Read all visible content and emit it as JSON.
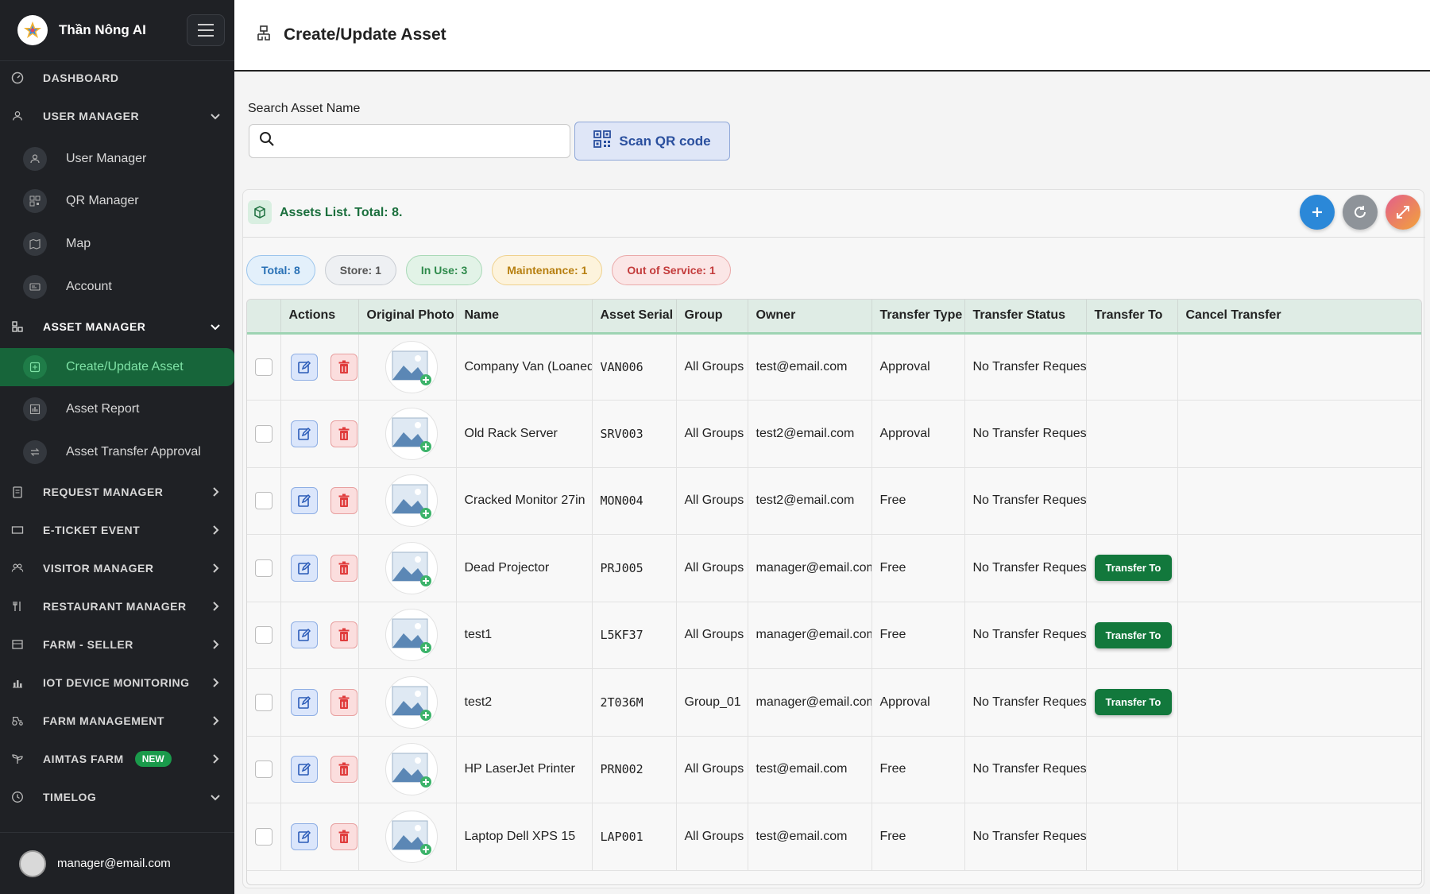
{
  "app": {
    "title": "Thần Nông AI"
  },
  "header": {
    "title": "Create/Update Asset"
  },
  "sidebar": {
    "top_items": [
      {
        "label": "DASHBOARD",
        "icon": "dashboard-icon"
      },
      {
        "label": "USER MANAGER",
        "icon": "users-icon",
        "expanded": true
      },
      {
        "label": "ASSET MANAGER",
        "icon": "asset-manager-icon",
        "expanded": true
      },
      {
        "label": "REQUEST MANAGER",
        "icon": "clipboard-icon"
      },
      {
        "label": "E-TICKET EVENT",
        "icon": "ticket-icon"
      },
      {
        "label": "VISITOR MANAGER",
        "icon": "visitors-icon"
      },
      {
        "label": "RESTAURANT MANAGER",
        "icon": "restaurant-icon"
      },
      {
        "label": "FARM - SELLER",
        "icon": "store-icon"
      },
      {
        "label": "IOT DEVICE MONITORING",
        "icon": "chart-icon"
      },
      {
        "label": "FARM MANAGEMENT",
        "icon": "tractor-icon"
      },
      {
        "label": "AIMTAS FARM",
        "icon": "plant-icon",
        "badge": "NEW"
      },
      {
        "label": "TIMELOG",
        "icon": "clock-icon",
        "expanded": true
      }
    ],
    "user_items": [
      {
        "label": "User Manager"
      },
      {
        "label": "QR Manager"
      },
      {
        "label": "Map"
      },
      {
        "label": "Account"
      }
    ],
    "asset_items": [
      {
        "label": "Create/Update Asset",
        "active": true
      },
      {
        "label": "Asset Report"
      },
      {
        "label": "Asset Transfer Approval"
      }
    ],
    "footer_email": "manager@email.com"
  },
  "search": {
    "label": "Search Asset Name",
    "placeholder": "",
    "value": ""
  },
  "scan_button": {
    "label": "Scan QR code"
  },
  "list": {
    "title": "Assets List. Total: 8.",
    "filters": [
      {
        "label": "Total: 8",
        "color": "#2770b5"
      },
      {
        "label": "Store: 1",
        "color": "#555555"
      },
      {
        "label": "In Use: 3",
        "color": "#2e8a4b"
      },
      {
        "label": "Maintenance: 1",
        "color": "#b77f10"
      },
      {
        "label": "Out of Service: 1",
        "color": "#c33b3b"
      }
    ],
    "columns": [
      "Actions",
      "Original Photo",
      "Name",
      "Asset Serial",
      "Group",
      "Owner",
      "Transfer Type",
      "Transfer Status",
      "Transfer To",
      "Cancel Transfer"
    ],
    "transfer_label": "Transfer To",
    "rows": [
      {
        "name": "Company Van (Loaned)",
        "serial": "VAN006",
        "group": "All Groups",
        "owner": "test@email.com",
        "transfer_type": "Approval",
        "transfer_status": "No Transfer Request",
        "transfer_to": false
      },
      {
        "name": "Old Rack Server",
        "serial": "SRV003",
        "group": "All Groups",
        "owner": "test2@email.com",
        "transfer_type": "Approval",
        "transfer_status": "No Transfer Request",
        "transfer_to": false
      },
      {
        "name": "Cracked Monitor 27in",
        "serial": "MON004",
        "group": "All Groups",
        "owner": "test2@email.com",
        "transfer_type": "Free",
        "transfer_status": "No Transfer Request",
        "transfer_to": false
      },
      {
        "name": "Dead Projector",
        "serial": "PRJ005",
        "group": "All Groups",
        "owner": "manager@email.com",
        "transfer_type": "Free",
        "transfer_status": "No Transfer Request",
        "transfer_to": true
      },
      {
        "name": "test1",
        "serial": "L5KF37",
        "group": "All Groups",
        "owner": "manager@email.com",
        "transfer_type": "Free",
        "transfer_status": "No Transfer Request",
        "transfer_to": true
      },
      {
        "name": "test2",
        "serial": "2T036M",
        "group": "Group_01",
        "owner": "manager@email.com",
        "transfer_type": "Approval",
        "transfer_status": "No Transfer Request",
        "transfer_to": true
      },
      {
        "name": "HP LaserJet Printer",
        "serial": "PRN002",
        "group": "All Groups",
        "owner": "test@email.com",
        "transfer_type": "Free",
        "transfer_status": "No Transfer Request",
        "transfer_to": false
      },
      {
        "name": "Laptop Dell XPS 15",
        "serial": "LAP001",
        "group": "All Groups",
        "owner": "test@email.com",
        "transfer_type": "Free",
        "transfer_status": "No Transfer Request",
        "transfer_to": false
      }
    ]
  },
  "colors": {
    "sidebar_bg": "#1f2125",
    "active_green": "#17653a",
    "accent_blue": "#2b88d8",
    "transfer_green": "#12783c"
  }
}
